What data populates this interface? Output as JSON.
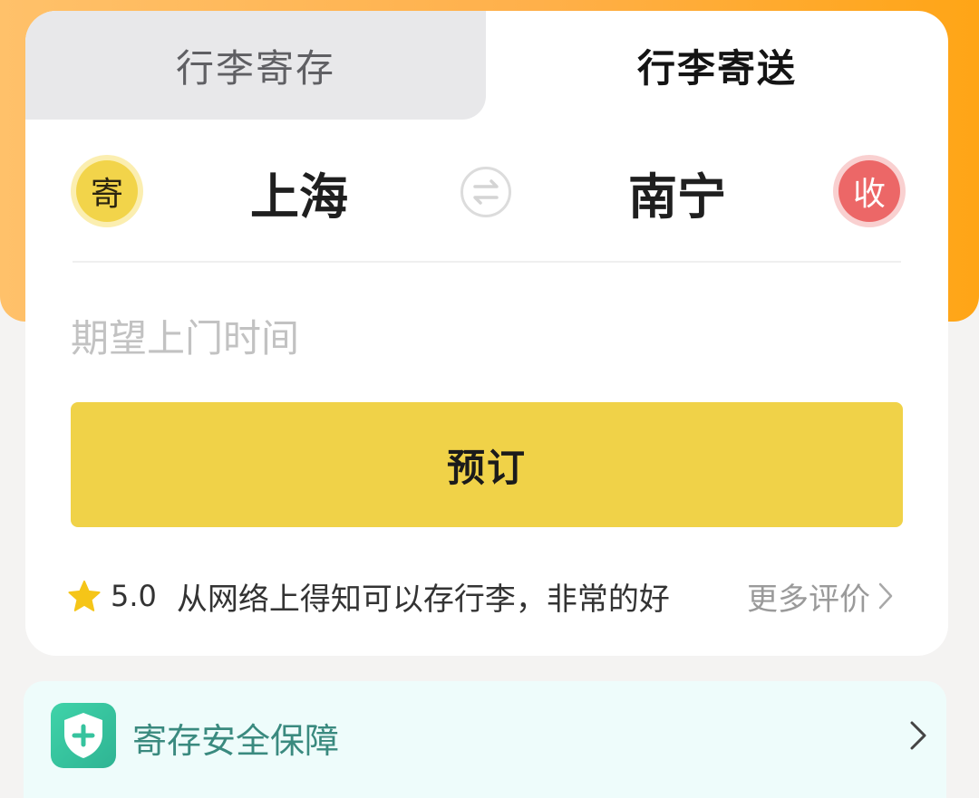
{
  "tabs": {
    "storage": "行李寄存",
    "delivery": "行李寄送"
  },
  "route": {
    "send_badge": "寄",
    "from_city": "上海",
    "to_city": "南宁",
    "receive_badge": "收"
  },
  "time_field": {
    "placeholder": "期望上门时间"
  },
  "book_button": "预订",
  "review": {
    "rating": "5.0",
    "text": "从网络上得知可以存行李，非常的好",
    "more_label": "更多评价"
  },
  "safety": {
    "label": "寄存安全保障"
  },
  "colors": {
    "accent_yellow": "#f0d248",
    "orange_bg": "#ffb04a",
    "receive_red": "#ec6767",
    "safety_green": "#3fd3a9"
  },
  "icons": {
    "swap": "swap-arrows-icon",
    "star": "star-icon",
    "shield": "shield-plus-icon",
    "chevron": "chevron-right-icon"
  }
}
